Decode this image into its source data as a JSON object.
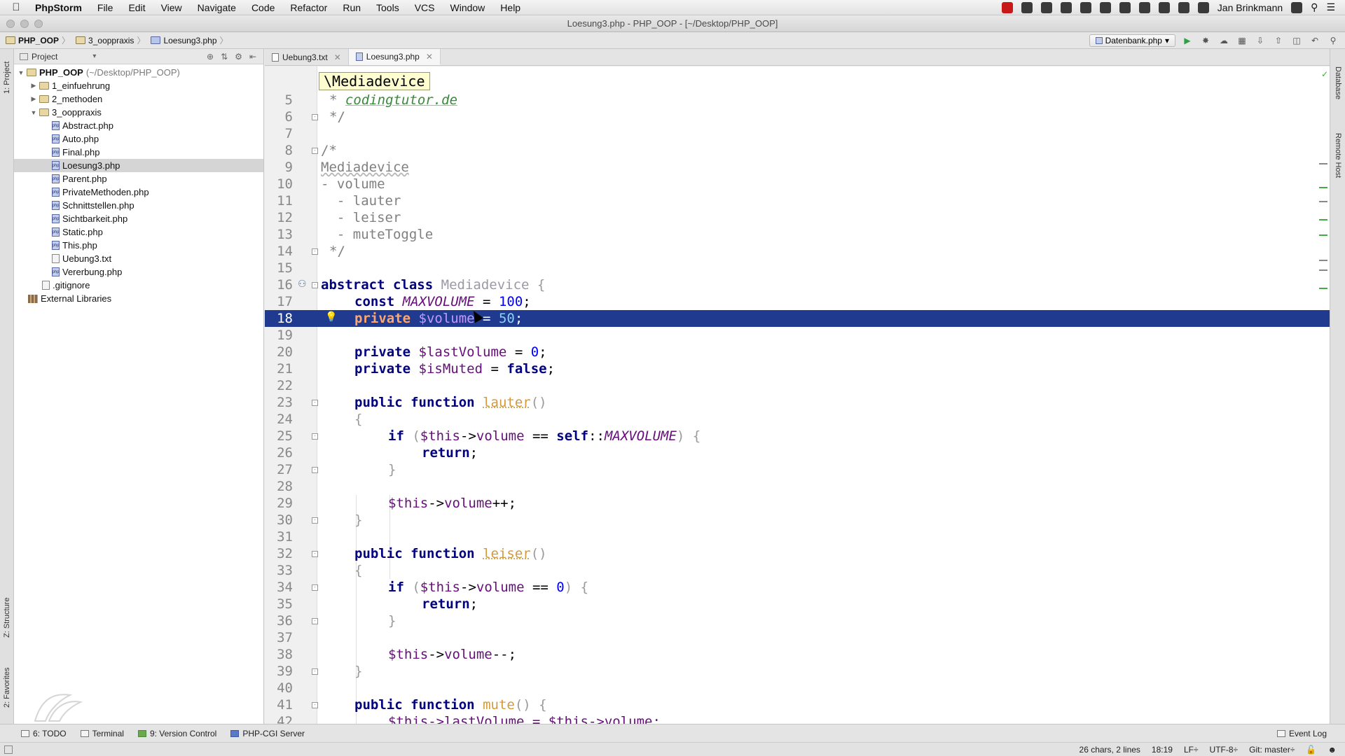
{
  "menubar": {
    "app_name": "PhpStorm",
    "items": [
      "File",
      "Edit",
      "View",
      "Navigate",
      "Code",
      "Refactor",
      "Run",
      "Tools",
      "VCS",
      "Window",
      "Help"
    ],
    "user": "Jan Brinkmann"
  },
  "window": {
    "title": "Loesung3.php - PHP_OOP - [~/Desktop/PHP_OOP]"
  },
  "breadcrumb": {
    "items": [
      "PHP_OOP",
      "3_ooppraxis",
      "Loesung3.php"
    ]
  },
  "toolbar": {
    "run_config": "Datenbank.php"
  },
  "left_strip": {
    "project_tab": "1: Project",
    "structure_tab": "Z: Structure",
    "favorites_tab": "2: Favorites"
  },
  "right_strip": {
    "database_tab": "Database",
    "remote_tab": "Remote Host"
  },
  "project_panel": {
    "header": "Project",
    "root_name": "PHP_OOP",
    "root_path": "(~/Desktop/PHP_OOP)",
    "folders": [
      "1_einfuehrung",
      "2_methoden",
      "3_ooppraxis"
    ],
    "files": [
      "Abstract.php",
      "Auto.php",
      "Final.php",
      "Loesung3.php",
      "Parent.php",
      "PrivateMethoden.php",
      "Schnittstellen.php",
      "Sichtbarkeit.php",
      "Static.php",
      "This.php",
      "Uebung3.txt",
      "Vererbung.php"
    ],
    "gitignore": ".gitignore",
    "external": "External Libraries"
  },
  "editor_tabs": [
    {
      "label": "Uebung3.txt"
    },
    {
      "label": "Loesung3.php"
    }
  ],
  "scope_tip": "\\Mediadevice",
  "code": {
    "line_numbers": [
      "5",
      "6",
      "7",
      "8",
      "9",
      "10",
      "11",
      "12",
      "13",
      "14",
      "15",
      "16",
      "17",
      "18",
      "19",
      "20",
      "21",
      "22",
      "23",
      "24",
      "25",
      "26",
      "27",
      "28",
      "29",
      "30",
      "31",
      "32",
      "33",
      "34",
      "35",
      "36",
      "37",
      "38",
      "39",
      "40",
      "41",
      "42"
    ],
    "comment_star": "* ",
    "comment_link": "codingtutor.de",
    "comment_end": "*/",
    "comment_open": "/*",
    "doc_title": "Mediadevice",
    "doc_volume": "- volume",
    "doc_lauter": "  - lauter",
    "doc_leiser": "  - leiser",
    "doc_mute": "  - muteToggle",
    "kw_abstract": "abstract",
    "kw_class": "class",
    "class_name": "Mediadevice",
    "kw_const": "const",
    "const_name": "MAXVOLUME",
    "const_value": "100",
    "kw_private": "private",
    "var_volume": "$volume",
    "volume_value": "50",
    "var_last_volume": "$lastVolume",
    "last_volume_value": "0",
    "var_is_muted": "$isMuted",
    "kw_false": "false",
    "kw_public": "public",
    "kw_function": "function",
    "fn_lauter": "lauter",
    "fn_leiser": "leiser",
    "fn_mute": "mute",
    "kw_if": "if",
    "kw_return": "return",
    "kw_self": "self",
    "this": "$this",
    "prop_volume": "volume",
    "zero": "0",
    "line42": "$this->lastVolume = $this->volume;"
  },
  "bottom_tools": {
    "todo": "6: TODO",
    "terminal": "Terminal",
    "version_control": "9: Version Control",
    "php_cgi": "PHP-CGI Server",
    "event_log": "Event Log"
  },
  "status": {
    "selection": "26 chars, 2 lines",
    "position": "18:19",
    "line_sep": "LF÷",
    "encoding": "UTF-8÷",
    "git": "Git: master÷"
  }
}
